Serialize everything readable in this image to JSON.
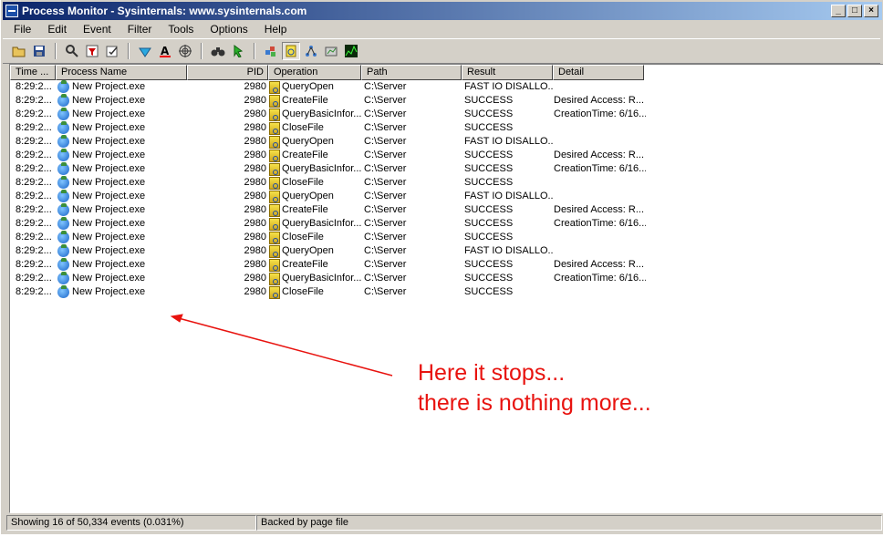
{
  "window": {
    "title": "Process Monitor - Sysinternals: www.sysinternals.com",
    "controls": [
      "_",
      "□",
      "×"
    ]
  },
  "menu": [
    "File",
    "Edit",
    "Event",
    "Filter",
    "Tools",
    "Options",
    "Help"
  ],
  "toolbar": {
    "icons": [
      "open-icon",
      "save-icon",
      "find-icon",
      "filter-icon",
      "edit-filter-icon",
      "highlight-icon",
      "jump-icon",
      "target-icon",
      "binoculars-icon",
      "jump-to-icon",
      "registry-icon",
      "filesystem-icon",
      "network-icon",
      "process-icon",
      "profiling-icon"
    ]
  },
  "columns": [
    "Time ...",
    "Process Name",
    "PID",
    "Operation",
    "Path",
    "Result",
    "Detail"
  ],
  "rows": [
    {
      "time": "8:29:2...",
      "process": "New Project.exe",
      "pid": "2980",
      "operation": "QueryOpen",
      "path": "C:\\Server",
      "result": "FAST IO DISALLO...",
      "detail": ""
    },
    {
      "time": "8:29:2...",
      "process": "New Project.exe",
      "pid": "2980",
      "operation": "CreateFile",
      "path": "C:\\Server",
      "result": "SUCCESS",
      "detail": "Desired Access: R..."
    },
    {
      "time": "8:29:2...",
      "process": "New Project.exe",
      "pid": "2980",
      "operation": "QueryBasicInfor...",
      "path": "C:\\Server",
      "result": "SUCCESS",
      "detail": "CreationTime: 6/16..."
    },
    {
      "time": "8:29:2...",
      "process": "New Project.exe",
      "pid": "2980",
      "operation": "CloseFile",
      "path": "C:\\Server",
      "result": "SUCCESS",
      "detail": ""
    },
    {
      "time": "8:29:2...",
      "process": "New Project.exe",
      "pid": "2980",
      "operation": "QueryOpen",
      "path": "C:\\Server",
      "result": "FAST IO DISALLO...",
      "detail": ""
    },
    {
      "time": "8:29:2...",
      "process": "New Project.exe",
      "pid": "2980",
      "operation": "CreateFile",
      "path": "C:\\Server",
      "result": "SUCCESS",
      "detail": "Desired Access: R..."
    },
    {
      "time": "8:29:2...",
      "process": "New Project.exe",
      "pid": "2980",
      "operation": "QueryBasicInfor...",
      "path": "C:\\Server",
      "result": "SUCCESS",
      "detail": "CreationTime: 6/16..."
    },
    {
      "time": "8:29:2...",
      "process": "New Project.exe",
      "pid": "2980",
      "operation": "CloseFile",
      "path": "C:\\Server",
      "result": "SUCCESS",
      "detail": ""
    },
    {
      "time": "8:29:2...",
      "process": "New Project.exe",
      "pid": "2980",
      "operation": "QueryOpen",
      "path": "C:\\Server",
      "result": "FAST IO DISALLO...",
      "detail": ""
    },
    {
      "time": "8:29:2...",
      "process": "New Project.exe",
      "pid": "2980",
      "operation": "CreateFile",
      "path": "C:\\Server",
      "result": "SUCCESS",
      "detail": "Desired Access: R..."
    },
    {
      "time": "8:29:2...",
      "process": "New Project.exe",
      "pid": "2980",
      "operation": "QueryBasicInfor...",
      "path": "C:\\Server",
      "result": "SUCCESS",
      "detail": "CreationTime: 6/16..."
    },
    {
      "time": "8:29:2...",
      "process": "New Project.exe",
      "pid": "2980",
      "operation": "CloseFile",
      "path": "C:\\Server",
      "result": "SUCCESS",
      "detail": ""
    },
    {
      "time": "8:29:2...",
      "process": "New Project.exe",
      "pid": "2980",
      "operation": "QueryOpen",
      "path": "C:\\Server",
      "result": "FAST IO DISALLO...",
      "detail": ""
    },
    {
      "time": "8:29:2...",
      "process": "New Project.exe",
      "pid": "2980",
      "operation": "CreateFile",
      "path": "C:\\Server",
      "result": "SUCCESS",
      "detail": "Desired Access: R..."
    },
    {
      "time": "8:29:2...",
      "process": "New Project.exe",
      "pid": "2980",
      "operation": "QueryBasicInfor...",
      "path": "C:\\Server",
      "result": "SUCCESS",
      "detail": "CreationTime: 6/16..."
    },
    {
      "time": "8:29:2...",
      "process": "New Project.exe",
      "pid": "2980",
      "operation": "CloseFile",
      "path": "C:\\Server",
      "result": "SUCCESS",
      "detail": ""
    }
  ],
  "status": {
    "events": "Showing 16 of 50,334 events (0.031%)",
    "backing": "Backed by page file"
  },
  "annotation": {
    "line1": "Here it stops...",
    "line2": "there is nothing more...",
    "color": "#e8130f"
  }
}
